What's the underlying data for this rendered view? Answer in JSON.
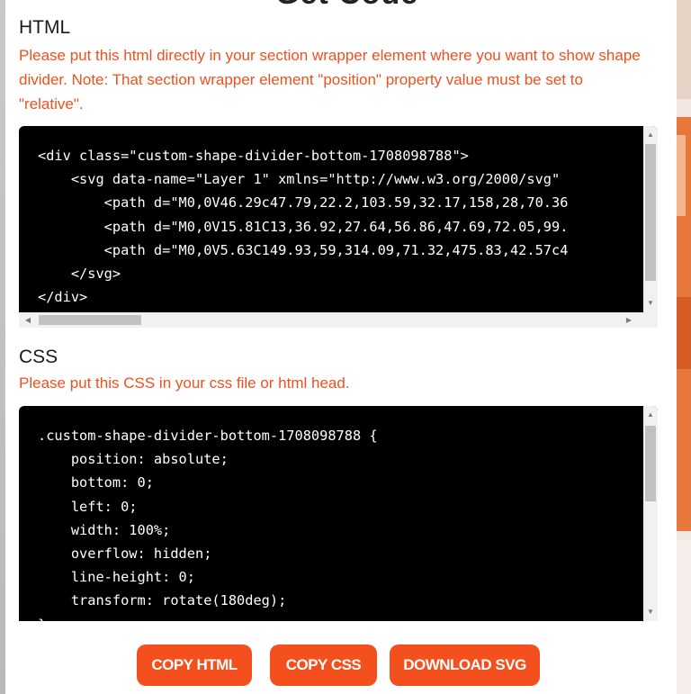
{
  "modal": {
    "title": "Get Code"
  },
  "html_section": {
    "heading": "HTML",
    "note": "Please put this html directly in your section wrapper element where you want to show shape divider. Note: That section wrapper element \"position\" property value must be set to \"relative\".",
    "code_lines": [
      "<div class=\"custom-shape-divider-bottom-1708098788\">",
      "    <svg data-name=\"Layer 1\" xmlns=\"http://www.w3.org/2000/svg\" ",
      "        <path d=\"M0,0V46.29c47.79,22.2,103.59,32.17,158,28,70.36",
      "        <path d=\"M0,0V15.81C13,36.92,27.64,56.86,47.69,72.05,99.",
      "        <path d=\"M0,0V5.63C149.93,59,314.09,71.32,475.83,42.57c4",
      "    </svg>",
      "</div>"
    ]
  },
  "css_section": {
    "heading": "CSS",
    "note": "Please put this CSS in your css file or html head.",
    "code_lines": [
      ".custom-shape-divider-bottom-1708098788 {",
      "    position: absolute;",
      "    bottom: 0;",
      "    left: 0;",
      "    width: 100%;",
      "    overflow: hidden;",
      "    line-height: 0;",
      "    transform: rotate(180deg);",
      "}"
    ]
  },
  "buttons": {
    "copy_html": "COPY HTML",
    "copy_css": "COPY CSS",
    "download_svg": "DOWNLOAD SVG"
  },
  "scroll": {
    "up_arrow": "▲",
    "down_arrow": "▼",
    "left_arrow": "◀",
    "right_arrow": "▶"
  },
  "colors": {
    "accent": "#f4501e",
    "note_text": "#f0501e",
    "code_bg": "#000000",
    "code_text": "#ffffff"
  }
}
